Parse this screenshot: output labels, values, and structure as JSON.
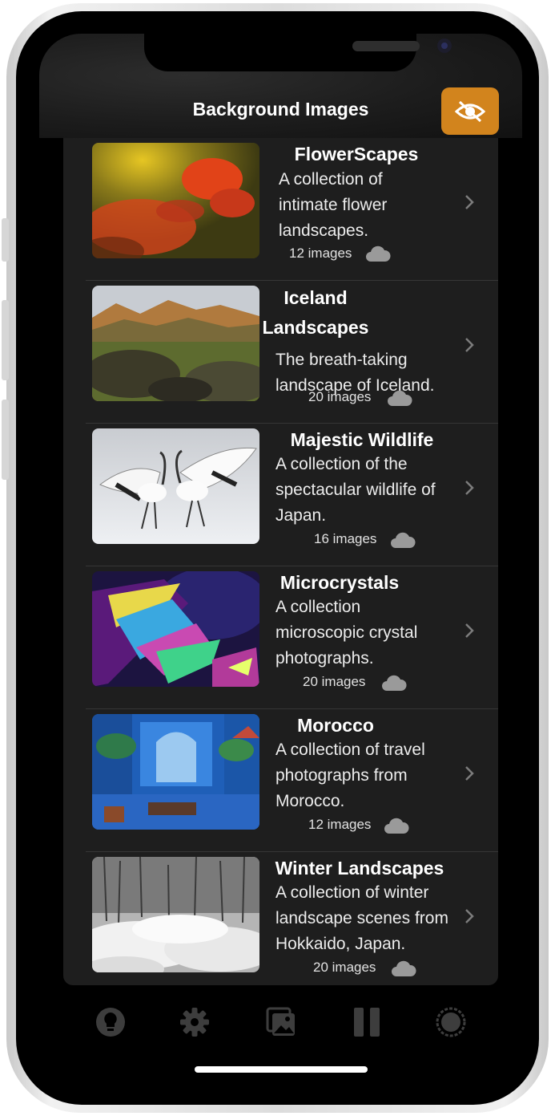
{
  "header": {
    "title": "Background Images",
    "hide_button_icon": "eye-slash-icon",
    "accent_color": "#d2841d"
  },
  "collections": [
    {
      "title": "FlowerScapes",
      "description": "A collection of intimate flower landscapes.",
      "count": "12 images"
    },
    {
      "title": "Iceland Landscapes",
      "description": "The breath-taking landscape of Iceland.",
      "count": "20 images"
    },
    {
      "title": "Majestic Wildlife",
      "description": "A collection of the spectacular wildlife of Japan.",
      "count": "16 images"
    },
    {
      "title": "Microcrystals",
      "description": "A collection microscopic crystal photographs.",
      "count": "20 images"
    },
    {
      "title": "Morocco",
      "description": "A collection of travel photographs from Morocco.",
      "count": "12 images"
    },
    {
      "title": "Winter Landscapes",
      "description": "A collection of winter landscape scenes from Hokkaido, Japan.",
      "count": "20 images"
    }
  ],
  "row_icons": {
    "download": "cloud-icon",
    "open": "chevron-right-icon"
  },
  "tabbar": {
    "tabs": [
      "lightbulb-icon",
      "gear-icon",
      "photo-stack-icon",
      "pause-icon",
      "circle-icon"
    ]
  }
}
